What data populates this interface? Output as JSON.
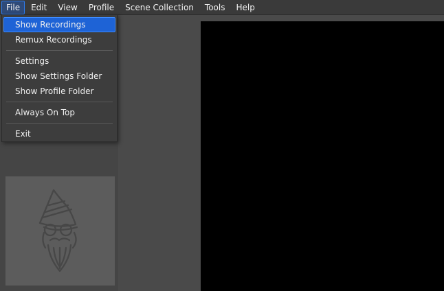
{
  "menubar": {
    "items": [
      "File",
      "Edit",
      "View",
      "Profile",
      "Scene Collection",
      "Tools",
      "Help"
    ]
  },
  "file_menu": {
    "items": [
      {
        "label": "Show Recordings",
        "selected": true
      },
      {
        "label": "Remux Recordings"
      },
      {
        "separator": true
      },
      {
        "label": "Settings"
      },
      {
        "label": "Show Settings Folder"
      },
      {
        "label": "Show Profile Folder"
      },
      {
        "separator": true
      },
      {
        "label": "Always On Top"
      },
      {
        "separator": true
      },
      {
        "label": "Exit"
      }
    ]
  },
  "mascot": {
    "icon": "gnome-mascot-icon"
  }
}
